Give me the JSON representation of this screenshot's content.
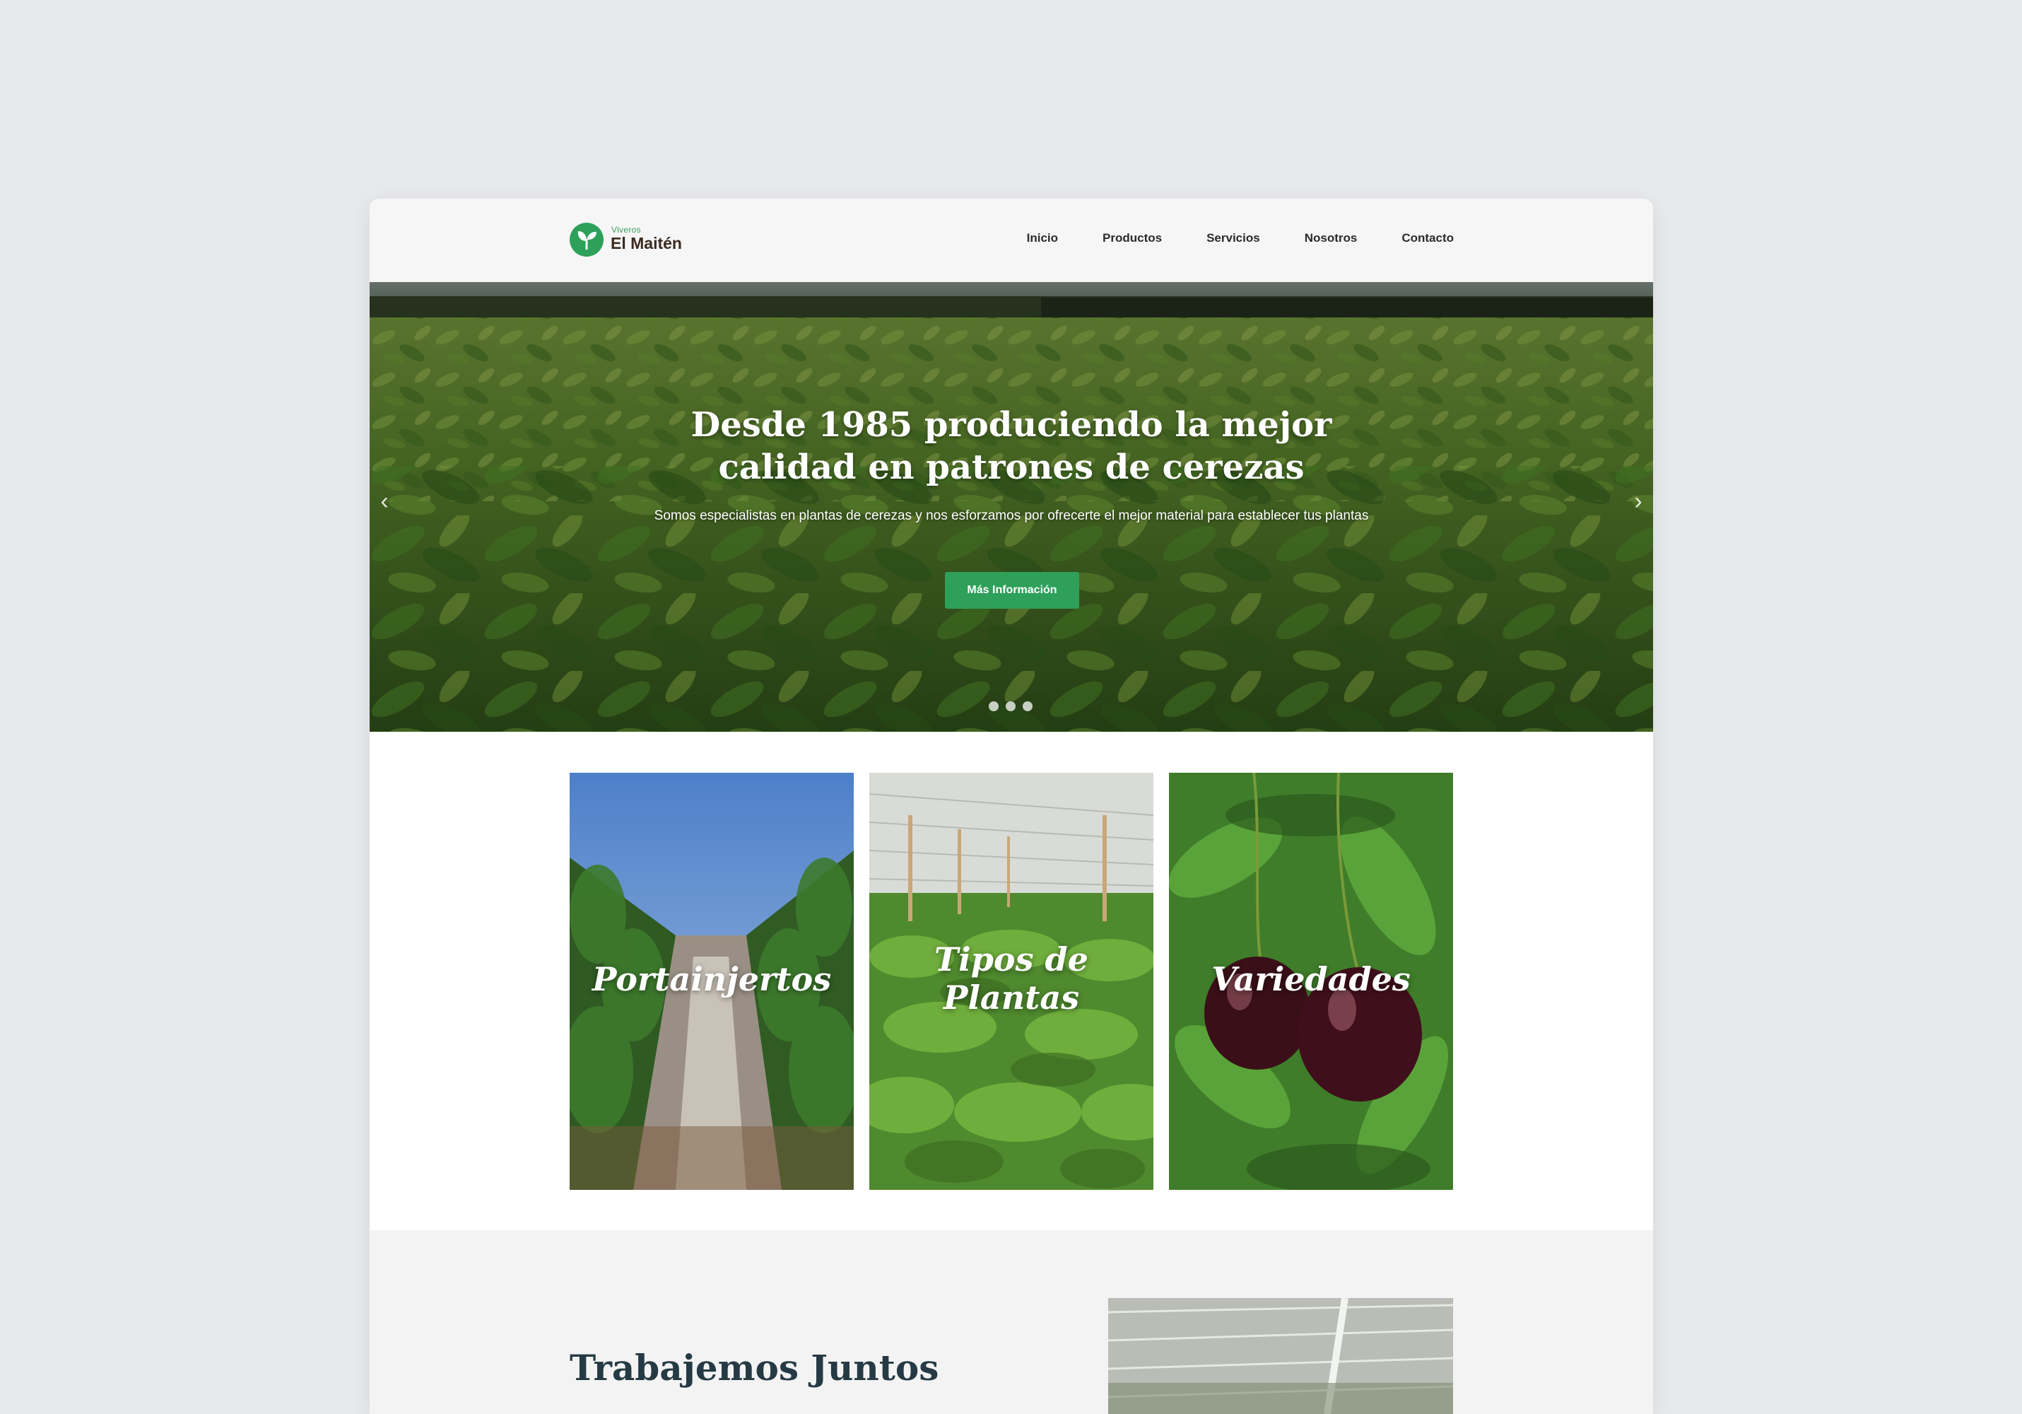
{
  "header": {
    "logo_small": "Viveros",
    "logo_name": "El Maitén",
    "nav": [
      "Inicio",
      "Productos",
      "Servicios",
      "Nosotros",
      "Contacto"
    ]
  },
  "hero": {
    "title": "Desde 1985 produciendo la mejor calidad en patrones de cerezas",
    "subtitle": "Somos especialistas en plantas de cerezas y nos esforzamos por ofrecerte el mejor material para establecer tus plantas",
    "button": "Más Información",
    "arrow_left": "‹",
    "arrow_right": "›",
    "slides": 3
  },
  "cards": [
    {
      "title": "Portainjertos"
    },
    {
      "title": "Tipos de Plantas"
    },
    {
      "title": "Variedades"
    }
  ],
  "section": {
    "title": "Trabajemos Juntos"
  },
  "colors": {
    "brand_green": "#2ea05a",
    "logo_brown": "#3b2a1e",
    "heading_dark": "#253a44"
  }
}
